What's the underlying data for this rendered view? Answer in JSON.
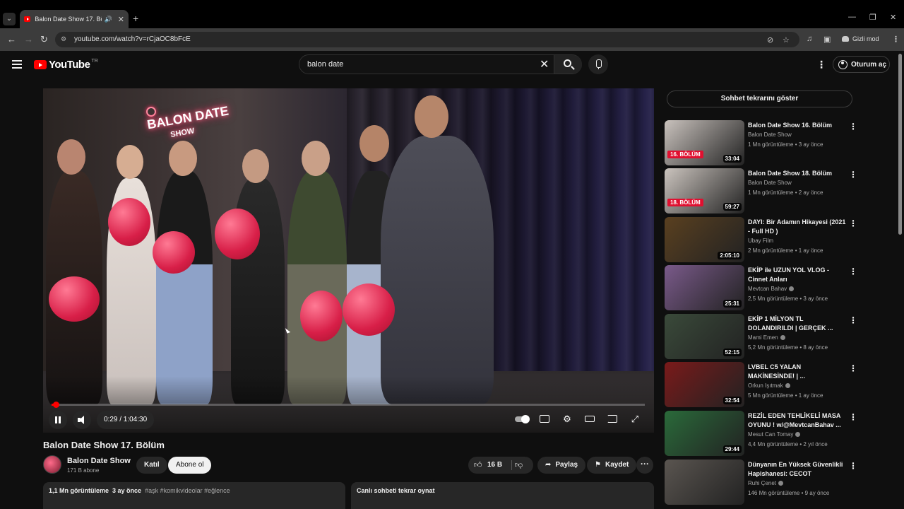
{
  "browser": {
    "tab_title": "Balon Date Show 17. Bölüm",
    "url": "youtube.com/watch?v=rCjaOC8bFcE",
    "incognito_label": "Gizli mod"
  },
  "header": {
    "logo_text": "YouTube",
    "country_code": "TR",
    "search_query": "balon date",
    "signin_label": "Oturum aç"
  },
  "player": {
    "time_display": "0:29 / 1:04:30",
    "progress_fraction": 0.0075,
    "sign_text": "BALON DATE",
    "sign_sub": "SHOW"
  },
  "video": {
    "title": "Balon Date Show 17. Bölüm",
    "channel_name": "Balon Date Show",
    "subscribers": "171 B abone",
    "join_label": "Katıl",
    "subscribe_label": "Abone ol",
    "likes": "16 B",
    "share_label": "Paylaş",
    "save_label": "Kaydet",
    "views": "1,1 Mn görüntüleme",
    "age": "3 ay önce",
    "tags": "#aşk #komikvideolar #eğlence",
    "chat_replay_box": "Canlı sohbeti tekrar oynat"
  },
  "sidebar": {
    "chat_replay_button": "Sohbet tekrarını göster",
    "recommendations": [
      {
        "title": "Balon Date Show 16. Bölüm",
        "channel": "Balon Date Show",
        "meta": "1 Mn görüntüleme • 3 ay önce",
        "duration": "33:04",
        "badge": "16. BÖLÜM",
        "verified": false,
        "color": "#c9c2bd"
      },
      {
        "title": "Balon Date Show 18. Bölüm",
        "channel": "Balon Date Show",
        "meta": "1 Mn görüntüleme • 2 ay önce",
        "duration": "59:27",
        "badge": "18. BÖLÜM",
        "verified": false,
        "color": "#cbc4be"
      },
      {
        "title": "DAYI: Bir Adamın Hikayesi (2021 - Full HD )",
        "channel": "Ubay Film",
        "meta": "2 Mn görüntüleme • 1 ay önce",
        "duration": "2:05:10",
        "badge": "",
        "verified": false,
        "color": "#5a4020"
      },
      {
        "title": "EKİP ile UZUN YOL VLOG - Cinnet Anları",
        "channel": "Mevtcan Bahav",
        "meta": "2,5 Mn görüntüleme • 3 ay önce",
        "duration": "25:31",
        "badge": "",
        "verified": true,
        "color": "#7a5a8a"
      },
      {
        "title": "EKİP 1 MİLYON TL DOLANDIRILDI | GERÇEK ...",
        "channel": "Mami Emen",
        "meta": "5,2 Mn görüntüleme • 8 ay önce",
        "duration": "52:15",
        "badge": "",
        "verified": true,
        "color": "#3a4a3a"
      },
      {
        "title": "LVBEL C5 YALAN MAKİNESİNDE! | ...",
        "channel": "Orkun Işıtmak",
        "meta": "5 Mn görüntüleme • 1 ay önce",
        "duration": "32:54",
        "badge": "",
        "verified": true,
        "color": "#7a1a1a"
      },
      {
        "title": "REZİL EDEN TEHLİKELİ MASA OYUNU ! w/@MevtcanBahav ...",
        "channel": "Mesut Can Tomay",
        "meta": "4,4 Mn görüntüleme • 2 yıl önce",
        "duration": "29:44",
        "badge": "",
        "verified": true,
        "color": "#2a6a3a"
      },
      {
        "title": "Dünyanın En Yüksek Güvenlikli Hapishanesi: CECOT (Şeytanla...",
        "channel": "Ruhi Çenet",
        "meta": "146 Mn görüntüleme • 9 ay önce",
        "duration": "",
        "badge": "",
        "verified": true,
        "color": "#5a5550"
      }
    ]
  }
}
